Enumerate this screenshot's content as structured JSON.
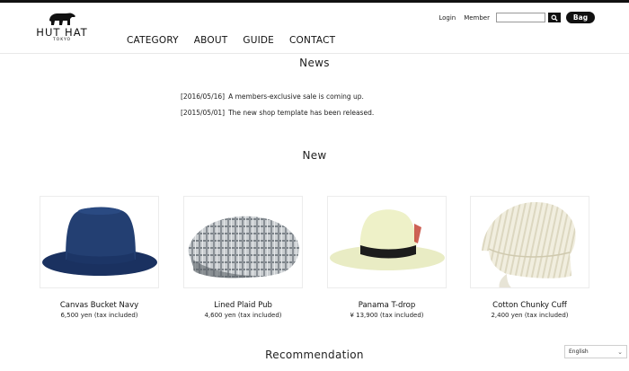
{
  "brand": {
    "name": "HUT HAT",
    "sub": "TOKYO"
  },
  "nav": [
    "CATEGORY",
    "ABOUT",
    "GUIDE",
    "CONTACT"
  ],
  "util": {
    "login": "Login",
    "member": "Member",
    "search_placeholder": "",
    "bag": "Bag"
  },
  "sections": {
    "news": "News",
    "new": "New",
    "recommendation": "Recommendation"
  },
  "news": [
    {
      "date": "[2016/05/16]",
      "text": "A members-exclusive sale is coming up."
    },
    {
      "date": "[2015/05/01]",
      "text": "The new shop template has been released."
    }
  ],
  "products": [
    {
      "name": "Canvas Bucket Navy",
      "price": "6,500 yen (tax included)"
    },
    {
      "name": "Lined Plaid Pub",
      "price": "4,600 yen (tax included)"
    },
    {
      "name": "Panama T-drop",
      "price": "¥ 13,900 (tax included)"
    },
    {
      "name": "Cotton Chunky Cuff",
      "price": "2,400 yen (tax included)"
    }
  ],
  "language": {
    "selected": "English"
  },
  "colors": {
    "accent": "#111111",
    "navy_hat": "#1f3a66",
    "panama_band": "#1c1c1c"
  }
}
